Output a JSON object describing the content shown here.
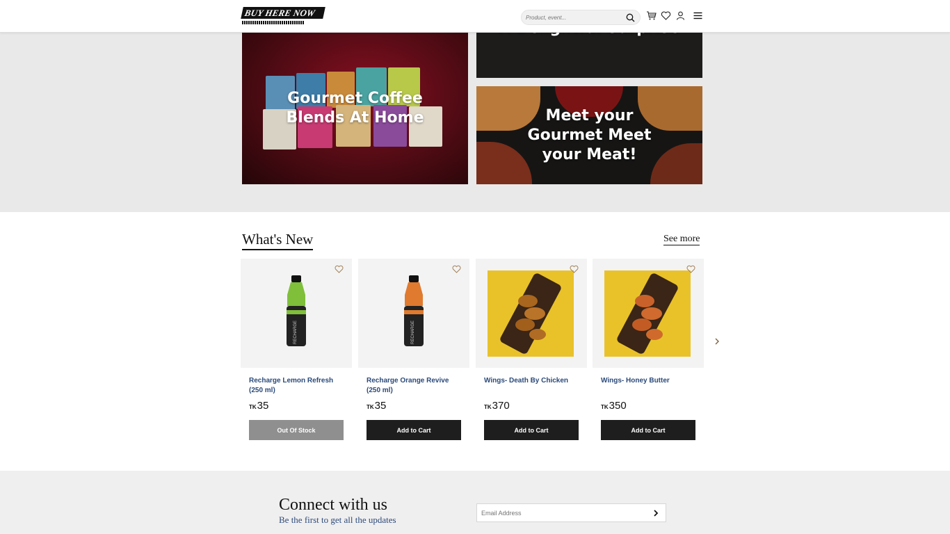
{
  "header": {
    "logo_text": "BUY HERE NOW",
    "search_placeholder": "Product, event..."
  },
  "banners": {
    "coffee": "Gourmet Coffee Blends At Home",
    "surprise": "A Delightful Surprise",
    "meat": "Meet your Gourmet Meet your Meat!"
  },
  "whats_new": {
    "title": "What's New",
    "see_more": "See more",
    "currency": "TK",
    "products": [
      {
        "name": "Recharge Lemon Refresh (250 ml)",
        "price": "35",
        "button": "Out Of Stock",
        "in_stock": false
      },
      {
        "name": "Recharge Orange Revive (250 ml)",
        "price": "35",
        "button": "Add to Cart",
        "in_stock": true
      },
      {
        "name": "Wings- Death By Chicken",
        "price": "370",
        "button": "Add to Cart",
        "in_stock": true
      },
      {
        "name": "Wings- Honey Butter",
        "price": "350",
        "button": "Add to Cart",
        "in_stock": true
      }
    ]
  },
  "footer": {
    "title": "Connect with us",
    "subtitle": "Be the first to get all the updates",
    "email_placeholder": "Email Address"
  },
  "icons": [
    "search-icon",
    "cart-icon",
    "heart-icon",
    "user-icon",
    "menu-icon",
    "chevron-right-icon",
    "arrow-right-icon"
  ],
  "colors": {
    "product_name": "#2b4a7a",
    "button": "#1e1e1e",
    "button_disabled": "#8f8f8f",
    "hero_band": "#e9e9e9",
    "footer_band": "#f0efef"
  }
}
